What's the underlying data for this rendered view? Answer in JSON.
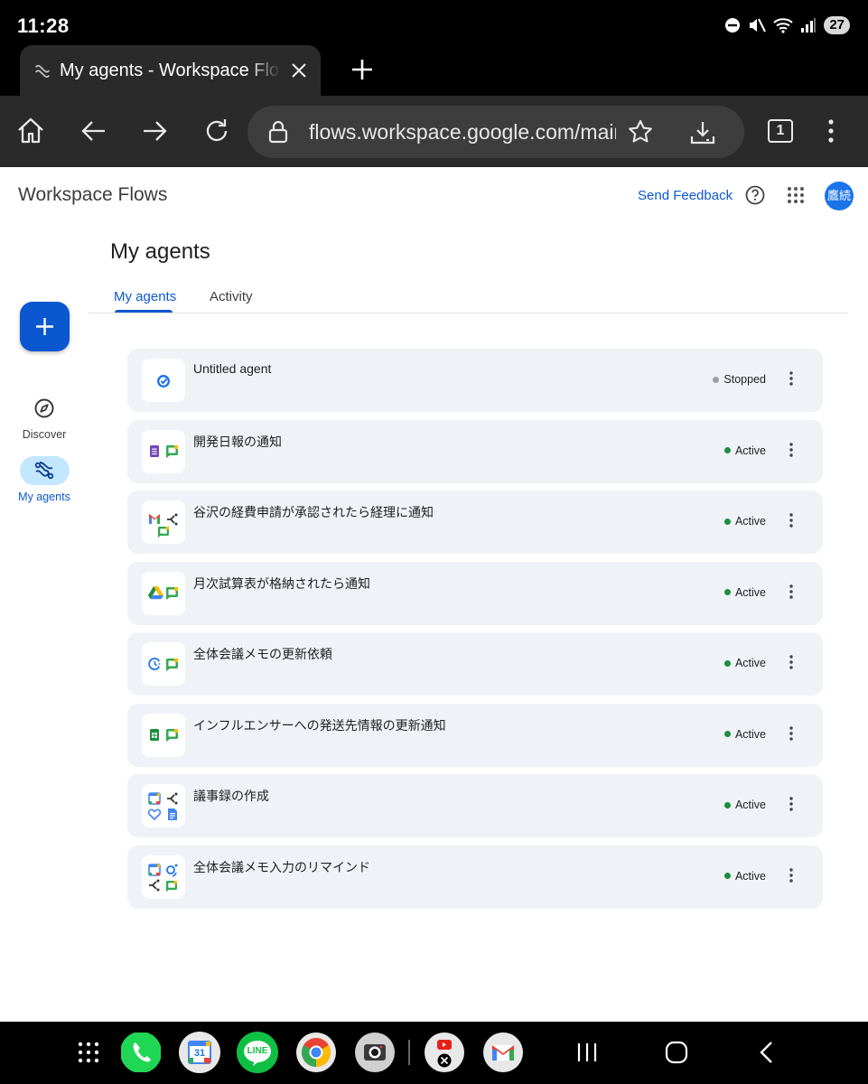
{
  "status_bar": {
    "time": "11:28",
    "battery": "27"
  },
  "browser": {
    "tab_title": "My agents - Workspace Flows",
    "url": "flows.workspace.google.com/main",
    "tab_count": "1"
  },
  "header": {
    "app_name": "Workspace Flows",
    "feedback_label": "Send Feedback",
    "avatar_text": "鷹続"
  },
  "rail": {
    "items": [
      {
        "label": "Discover",
        "icon": "compass-icon"
      },
      {
        "label": "My agents",
        "icon": "flow-icon"
      }
    ]
  },
  "page": {
    "title": "My agents",
    "tabs": [
      {
        "label": "My agents"
      },
      {
        "label": "Activity"
      }
    ]
  },
  "agents": [
    {
      "name": "Untitled agent",
      "status": "Stopped",
      "icons": [
        "untitled-flow-icon"
      ]
    },
    {
      "name": "開発日報の通知",
      "status": "Active",
      "icons": [
        "forms-icon",
        "chat-icon"
      ]
    },
    {
      "name": "谷沢の経費申請が承認されたら経理に通知",
      "status": "Active",
      "icons": [
        "gmail-icon",
        "branch-icon",
        "chat-icon"
      ]
    },
    {
      "name": "月次試算表が格納されたら通知",
      "status": "Active",
      "icons": [
        "drive-icon",
        "chat-icon"
      ]
    },
    {
      "name": "全体会議メモの更新依頼",
      "status": "Active",
      "icons": [
        "schedule-icon",
        "chat-icon"
      ]
    },
    {
      "name": "インフルエンサーへの発送先情報の更新通知",
      "status": "Active",
      "icons": [
        "sheets-icon",
        "chat-icon"
      ]
    },
    {
      "name": "議事録の作成",
      "status": "Active",
      "icons": [
        "calendar-icon",
        "branch-icon",
        "gemini-icon",
        "docs-icon"
      ]
    },
    {
      "name": "全体会議メモ入力のリマインド",
      "status": "Active",
      "icons": [
        "calendar-icon",
        "search-agent-icon",
        "branch-icon",
        "chat-icon"
      ]
    }
  ],
  "colors": {
    "accent": "#0b57d0",
    "active_dot": "#1e8e3e",
    "stopped_dot": "#9aa0a6",
    "card_bg": "#eff2f7"
  },
  "dock": {
    "calendar_day": "31",
    "line_label": "LINE"
  }
}
